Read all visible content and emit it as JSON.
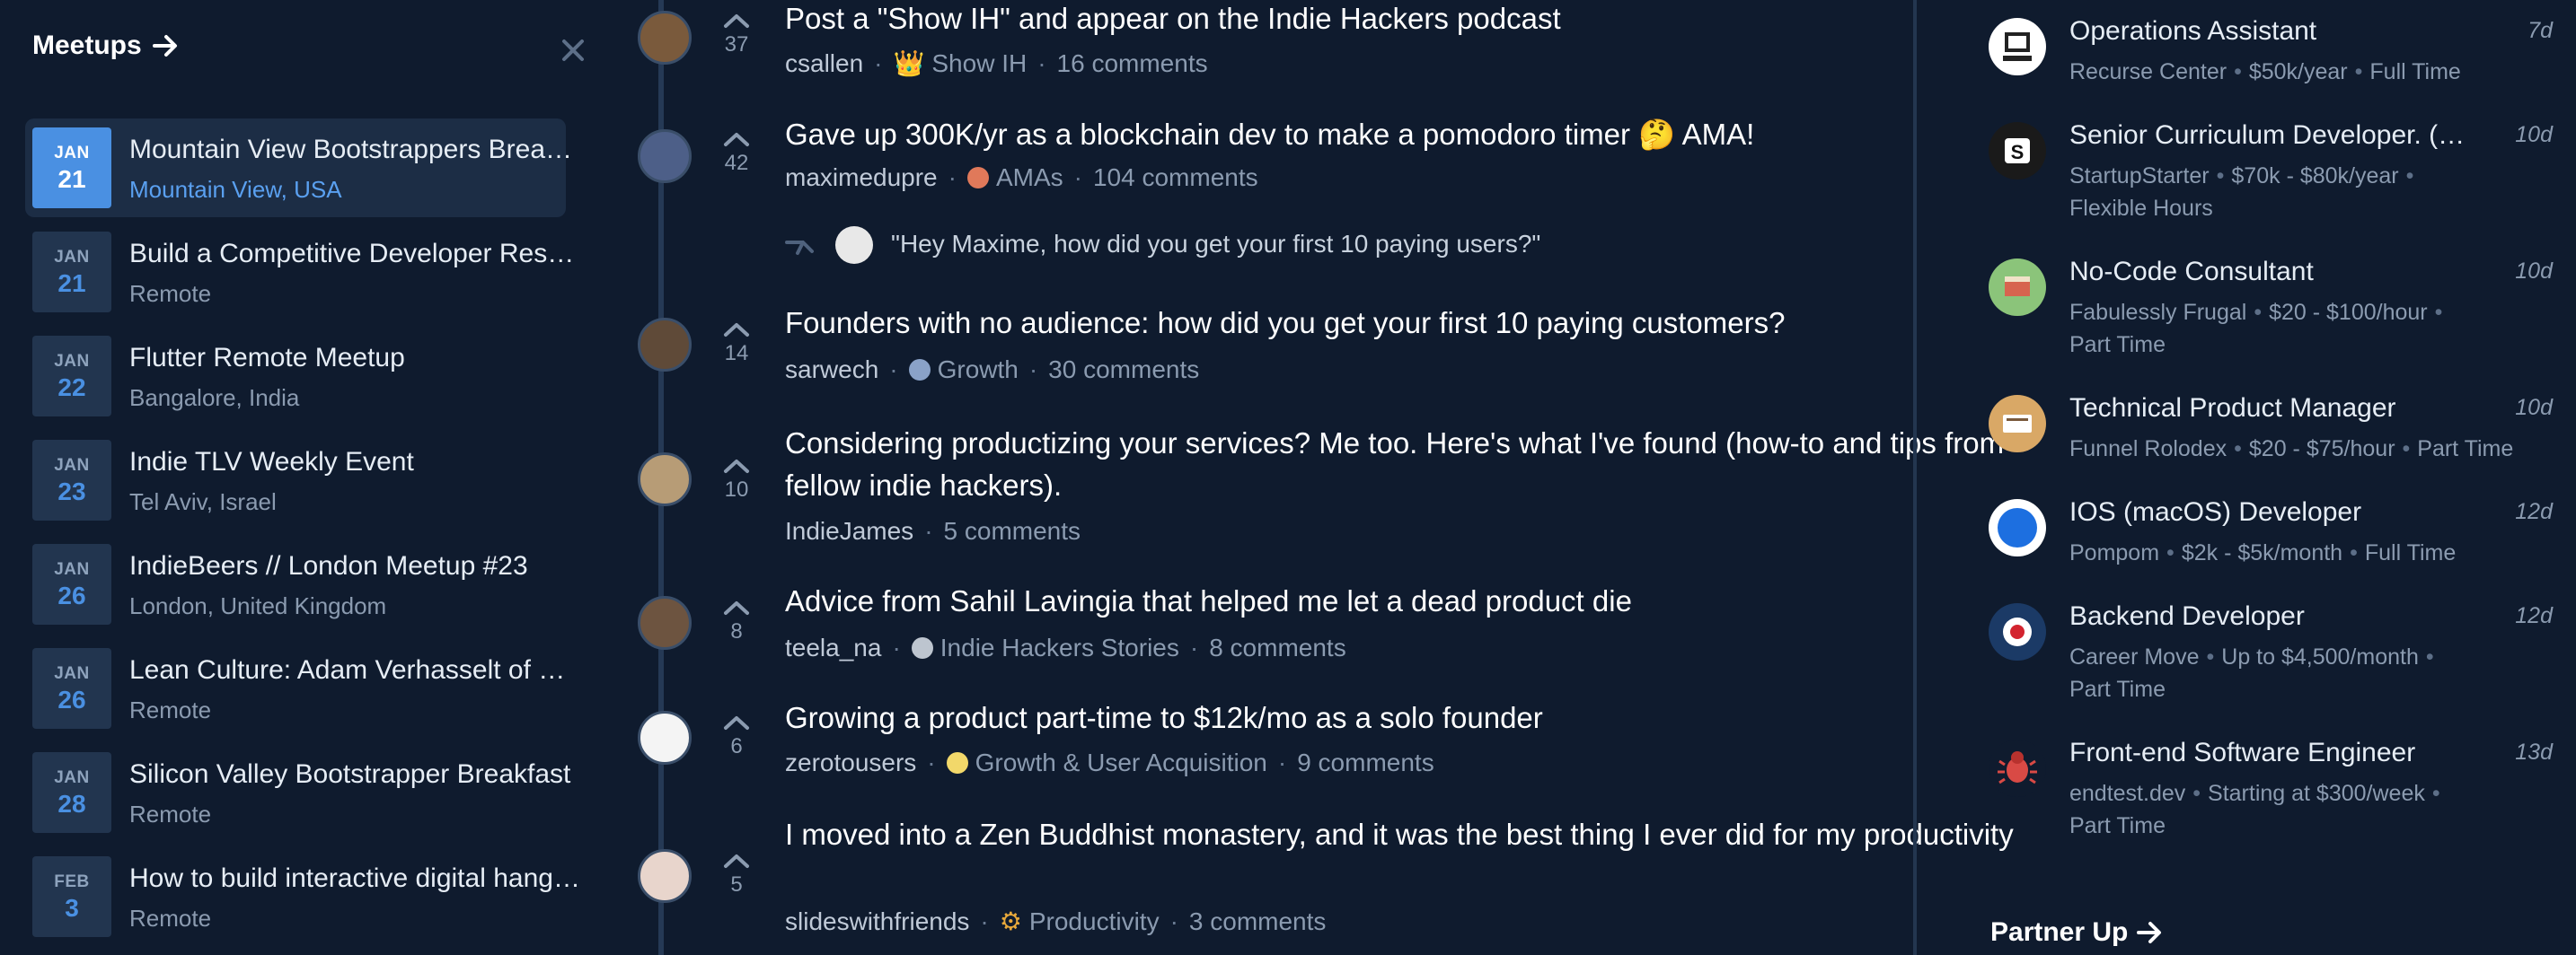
{
  "meetups": {
    "title": "Meetups",
    "items": [
      {
        "month": "JAN",
        "day": "21",
        "title": "Mountain View Bootstrappers Breakfast",
        "location": "Mountain View, USA",
        "active": true
      },
      {
        "month": "JAN",
        "day": "21",
        "title": "Build a Competitive Developer Resume",
        "location": "Remote"
      },
      {
        "month": "JAN",
        "day": "22",
        "title": "Flutter Remote Meetup",
        "location": "Bangalore, India"
      },
      {
        "month": "JAN",
        "day": "23",
        "title": "Indie TLV Weekly Event",
        "location": "Tel Aviv, Israel"
      },
      {
        "month": "JAN",
        "day": "26",
        "title": "IndieBeers // London Meetup #23",
        "location": "London, United Kingdom"
      },
      {
        "month": "JAN",
        "day": "26",
        "title": "Lean Culture: Adam Verhasselt of …",
        "location": "Remote"
      },
      {
        "month": "JAN",
        "day": "28",
        "title": "Silicon Valley Bootstrapper Breakfast",
        "location": "Remote"
      },
      {
        "month": "FEB",
        "day": "3",
        "title": "How to build interactive digital hangouts",
        "location": "Remote"
      }
    ]
  },
  "feed": {
    "posts": [
      {
        "votes": "37",
        "title": "Post a \"Show IH\" and appear on the Indie Hackers podcast",
        "author": "csallen",
        "group": "Show IH",
        "group_icon": "crown-icon",
        "comments": "16 comments"
      },
      {
        "votes": "42",
        "title": "Gave up 300K/yr as a blockchain dev to make a pomodoro timer 🤔  AMA!",
        "author": "maximedupre",
        "group": "AMAs",
        "group_icon": "ama-icon",
        "comments": "104 comments"
      },
      {
        "votes": "14",
        "title": "Founders with no audience: how did you get your first 10 paying customers?",
        "author": "sarwech",
        "group": "Growth",
        "group_icon": "growth-icon",
        "comments": "30 comments"
      },
      {
        "votes": "10",
        "title": "Considering productizing your services? Me too. Here's what I've found (how-to and tips from fellow indie hackers).",
        "author": "IndieJames",
        "comments": "5 comments"
      },
      {
        "votes": "8",
        "title": "Advice from Sahil Lavingia that helped me let a dead product die",
        "author": "teela_na",
        "group": "Indie Hackers Stories",
        "group_icon": "stories-icon",
        "comments": "8 comments"
      },
      {
        "votes": "6",
        "title": "Growing a product part-time to $12k/mo as a solo founder",
        "author": "zerotousers",
        "group": "Growth & User Acquisition",
        "group_icon": "acquisition-icon",
        "comments": "9 comments"
      },
      {
        "votes": "5",
        "title": "I moved into a Zen Buddhist monastery, and it was the best thing I ever did for my productivity",
        "author": "slideswithfriends",
        "group": "Productivity",
        "group_icon": "gear-icon",
        "comments": "3 comments"
      }
    ],
    "reply": "\"Hey Maxime, how did you get your first 10 paying users?\""
  },
  "jobs": {
    "items": [
      {
        "title": "Operations Assistant",
        "age": "7d",
        "meta": [
          "Recurse Center",
          "$50k/year",
          "Full Time"
        ],
        "logo_color": "#ffffff"
      },
      {
        "title": "Senior Curriculum Developer. (Bootcamp)",
        "age": "10d",
        "meta": [
          "StartupStarter",
          "$70k - $80k/year",
          "Flexible Hours"
        ],
        "logo_color": "#1a1a1a"
      },
      {
        "title": "No-Code Consultant",
        "age": "10d",
        "meta": [
          "Fabulessly Frugal",
          "$20 - $100/hour",
          "Part Time"
        ],
        "logo_color": "#8bc47a"
      },
      {
        "title": "Technical Product Manager",
        "age": "10d",
        "meta": [
          "Funnel Rolodex",
          "$20 - $75/hour",
          "Part Time"
        ],
        "logo_color": "#d9a866"
      },
      {
        "title": "IOS (macOS) Developer",
        "age": "12d",
        "meta": [
          "Pompom",
          "$2k - $5k/month",
          "Full Time"
        ],
        "logo_color": "#ffffff"
      },
      {
        "title": "Backend Developer",
        "age": "12d",
        "meta": [
          "Career Move",
          "Up to $4,500/month",
          "Part Time"
        ],
        "logo_color": "#1b3a66"
      },
      {
        "title": "Front-end Software Engineer",
        "age": "13d",
        "meta": [
          "endtest.dev",
          "Starting at $300/week",
          "Part Time"
        ],
        "logo_color": "#0f1b2e"
      }
    ],
    "partner_title": "Partner Up"
  },
  "colors": {
    "background": "#0f1b2e",
    "accent": "#4a90e2",
    "muted": "#8b9bb0"
  }
}
